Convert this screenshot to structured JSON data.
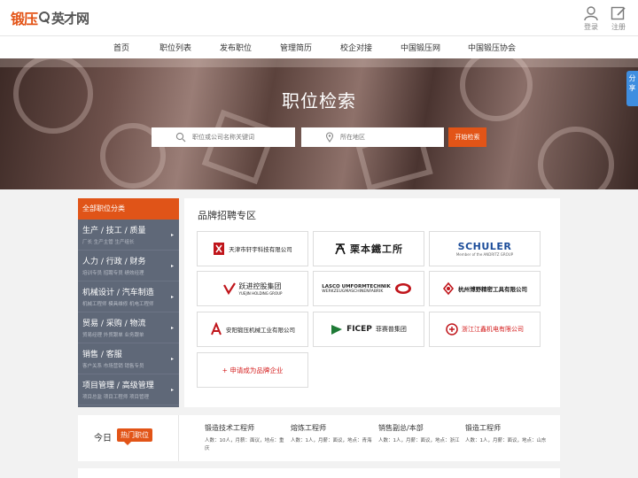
{
  "header": {
    "logo_part1": "锻压",
    "logo_part2": "英才网",
    "login_label": "登录",
    "register_label": "注册"
  },
  "nav": {
    "items": [
      "首页",
      "职位列表",
      "发布职位",
      "管理简历",
      "校企对接",
      "中国锻压网",
      "中国锻压协会"
    ]
  },
  "banner": {
    "title": "职位检索",
    "keyword_placeholder": "职位或公司名称关键词",
    "area_placeholder": "所在地区",
    "search_button": "开始检索",
    "share_label": "分享"
  },
  "categories": {
    "header": "全部职位分类",
    "items": [
      {
        "title": "生产 / 技工 / 质量",
        "sub": "厂长  生产主管  生产组长"
      },
      {
        "title": "人力 / 行政 / 财务",
        "sub": "培训专员  招聘专员  绩效经理"
      },
      {
        "title": "机械设计 / 汽车制造",
        "sub": "机械工程师  模具维修  机电工程师"
      },
      {
        "title": "贸易 / 采购 / 物流",
        "sub": "贸易经理  外贸跟单  业务跟单"
      },
      {
        "title": "销售 / 客服",
        "sub": "客户关系  市场营销  销售专员"
      },
      {
        "title": "项目管理 / 高级管理",
        "sub": "项目总监  项目工程师  项目管理"
      }
    ]
  },
  "brand_zone": {
    "title": "品牌招聘专区",
    "brands": [
      {
        "name": "天津市轩宇科技有限公司",
        "style": "normal",
        "mark_color": "#c0151b"
      },
      {
        "name": "栗本鐵工所",
        "style": "big",
        "mark_color": "#111111"
      },
      {
        "name": "SCHULER",
        "sub": "Member of the ANDRITZ GROUP",
        "style": "sch",
        "mark_color": "#1b4c9a"
      },
      {
        "name": "跃进控股集团",
        "sub": "YUEJIN HOLDING GROUP",
        "style": "normal",
        "mark_color": "#c0151b"
      },
      {
        "name": "LASCO UMFORMTECHNIK",
        "sub": "WERKZEUGMASCHINENFABRIK",
        "style": "normal",
        "mark_color": "#c0151b"
      },
      {
        "name": "杭州博野精密工具有限公司",
        "style": "normal",
        "mark_color": "#c0151b"
      },
      {
        "name": "安阳锻压机械工业有限公司",
        "style": "normal",
        "mark_color": "#c0151b"
      },
      {
        "name": "菲赛普集团",
        "brand": "FICEP",
        "style": "normal",
        "mark_color": "#1e7a36"
      },
      {
        "name": "浙江江鑫机电有限公司",
        "style": "red",
        "mark_color": "#c0151b"
      }
    ],
    "apply_link": "+ 申请成为品牌企业"
  },
  "hot_jobs": {
    "today": "今日",
    "tag": "热门职位",
    "jobs": [
      {
        "title": "锻造技术工程师",
        "detail": "人数：10人，月薪：面议，地点：重庆"
      },
      {
        "title": "熔炼工程师",
        "detail": "人数：1人，月薪：面议，地点：青海"
      },
      {
        "title": "销售副总/本部",
        "detail": "人数：1人，月薪：面议，地点：浙江"
      },
      {
        "title": "锻造工程师",
        "detail": "人数：1人，月薪：面议，地点：山东"
      }
    ]
  }
}
